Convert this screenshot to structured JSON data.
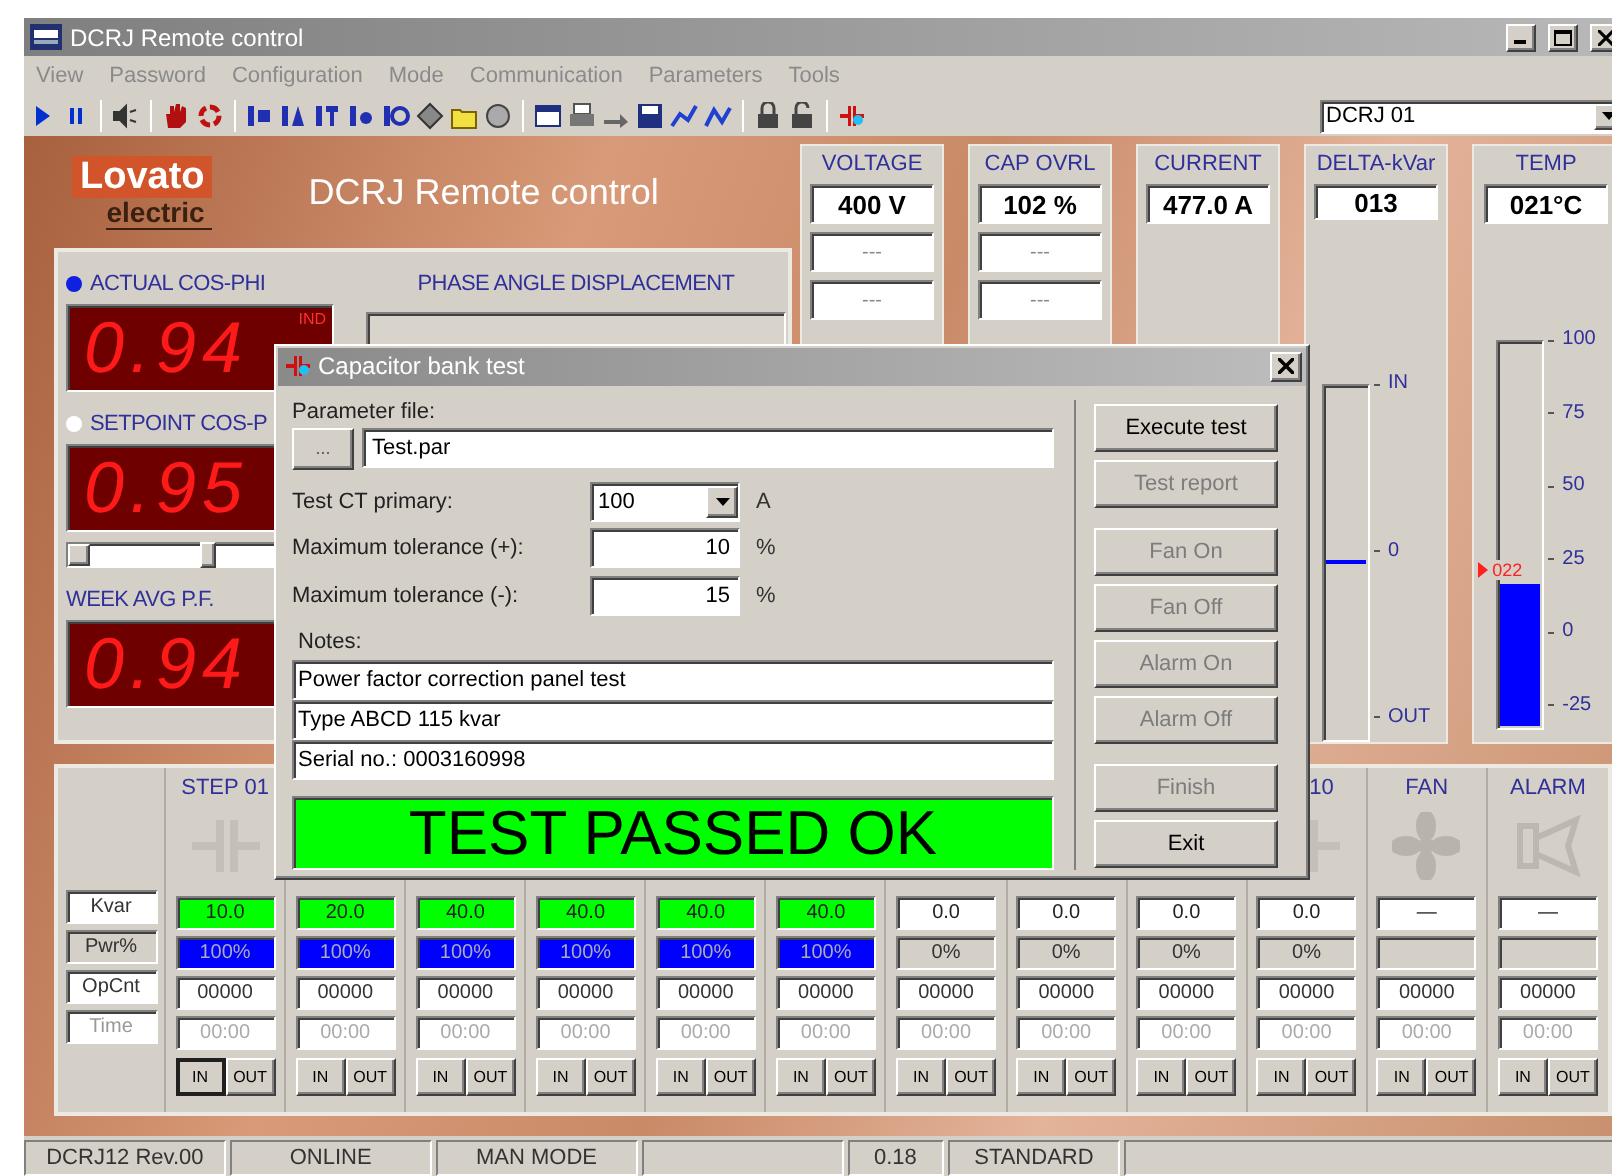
{
  "window": {
    "title": "DCRJ Remote control"
  },
  "menu": [
    "View",
    "Password",
    "Configuration",
    "Mode",
    "Communication",
    "Parameters",
    "Tools"
  ],
  "device_select": {
    "value": "DCRJ 01"
  },
  "header": {
    "logo_top": "Lovato",
    "logo_bottom": "electric",
    "title": "DCRJ Remote control"
  },
  "cos_phi": {
    "displays": [
      {
        "label": "ACTUAL COS-PHI",
        "selected": true,
        "value": "0.94",
        "unit": "IND"
      },
      {
        "label": "SETPOINT COS-P",
        "selected": false,
        "value": "0.95",
        "slider": {
          "level": 0.5
        }
      },
      {
        "label": "WEEK AVG P.F.",
        "value": "0.94"
      }
    ],
    "phase_angle": {
      "label": "PHASE ANGLE DISPLACEMENT"
    }
  },
  "meters": [
    {
      "label": "VOLTAGE",
      "value": "400 V",
      "extra": [
        "---",
        "---"
      ]
    },
    {
      "label": "CAP OVRL",
      "value": "102 %",
      "extra": [
        "---",
        "---"
      ]
    },
    {
      "label": "CURRENT",
      "value": "477.0 A"
    },
    {
      "label": "DELTA-kVar",
      "value": "013",
      "gauge": {
        "kind": "marker",
        "level": 0.5,
        "ticks": [
          "IN",
          "0",
          "OUT"
        ]
      }
    },
    {
      "label": "TEMP",
      "value": "021°C",
      "gauge": {
        "kind": "fill",
        "level": 0.376,
        "reading": "022",
        "ticks": [
          "100",
          "75",
          "50",
          "25",
          "0",
          "-25"
        ]
      }
    }
  ],
  "steps": {
    "row_labels": [
      "Kvar",
      "Pwr%",
      "OpCnt",
      "Time"
    ],
    "columns": [
      {
        "header": "STEP 01",
        "kind": "step",
        "kvar": "10.0",
        "active": true,
        "power": "100%",
        "opcnt": "00000",
        "time": "00:00",
        "buttons": [
          {
            "label": "IN",
            "selected": true
          },
          {
            "label": "OUT",
            "selected": false
          }
        ]
      },
      {
        "kvar": "20.0",
        "active": true,
        "power": "100%",
        "opcnt": "00000",
        "time": "00:00",
        "buttons": [
          {
            "label": "IN",
            "selected": false
          },
          {
            "label": "OUT",
            "selected": false
          }
        ]
      },
      {
        "kvar": "40.0",
        "active": true,
        "power": "100%",
        "opcnt": "00000",
        "time": "00:00",
        "buttons": [
          {
            "label": "IN",
            "selected": false
          },
          {
            "label": "OUT",
            "selected": false
          }
        ]
      },
      {
        "kvar": "40.0",
        "active": true,
        "power": "100%",
        "opcnt": "00000",
        "time": "00:00",
        "buttons": [
          {
            "label": "IN",
            "selected": false
          },
          {
            "label": "OUT",
            "selected": false
          }
        ]
      },
      {
        "kvar": "40.0",
        "active": true,
        "power": "100%",
        "opcnt": "00000",
        "time": "00:00",
        "buttons": [
          {
            "label": "IN",
            "selected": false
          },
          {
            "label": "OUT",
            "selected": false
          }
        ]
      },
      {
        "kvar": "40.0",
        "active": true,
        "power": "100%",
        "opcnt": "00000",
        "time": "00:00",
        "buttons": [
          {
            "label": "IN",
            "selected": false
          },
          {
            "label": "OUT",
            "selected": false
          }
        ]
      },
      {
        "kvar": "0.0",
        "active": false,
        "power": "0%",
        "opcnt": "00000",
        "time": "00:00",
        "buttons": [
          {
            "label": "IN",
            "selected": false
          },
          {
            "label": "OUT",
            "selected": false
          }
        ]
      },
      {
        "kvar": "0.0",
        "active": false,
        "power": "0%",
        "opcnt": "00000",
        "time": "00:00",
        "buttons": [
          {
            "label": "IN",
            "selected": false
          },
          {
            "label": "OUT",
            "selected": false
          }
        ]
      },
      {
        "kvar": "0.0",
        "active": false,
        "power": "0%",
        "opcnt": "00000",
        "time": "00:00",
        "buttons": [
          {
            "label": "IN",
            "selected": false
          },
          {
            "label": "OUT",
            "selected": false
          }
        ]
      },
      {
        "header": "10",
        "kind": "step",
        "kvar": "0.0",
        "active": false,
        "power": "0%",
        "opcnt": "00000",
        "time": "00:00",
        "buttons": [
          {
            "label": "IN",
            "selected": false
          },
          {
            "label": "OUT",
            "selected": false
          }
        ]
      },
      {
        "header": "FAN",
        "kind": "fan",
        "kvar": "—",
        "active": false,
        "opcnt": "00000",
        "time": "00:00",
        "buttons": [
          {
            "label": "IN",
            "selected": false
          },
          {
            "label": "OUT",
            "selected": false
          }
        ]
      },
      {
        "header": "ALARM",
        "kind": "alarm",
        "kvar": "—",
        "active": false,
        "opcnt": "00000",
        "time": "00:00",
        "buttons": [
          {
            "label": "IN",
            "selected": false
          },
          {
            "label": "OUT",
            "selected": false
          }
        ]
      }
    ]
  },
  "status_bar": [
    "DCRJ12 Rev.00",
    "ONLINE",
    "MAN MODE",
    "0.18",
    "STANDARD"
  ],
  "dialog": {
    "title": "Capacitor bank test",
    "parameter_file": {
      "label": "Parameter file:",
      "browse": "...",
      "value": "Test.par"
    },
    "fields": [
      {
        "kind": "select",
        "label": "Test CT primary:",
        "value": "100",
        "unit": "A"
      },
      {
        "kind": "input",
        "label": "Maximum tolerance (+):",
        "value": "10",
        "unit": "%"
      },
      {
        "kind": "input",
        "label": "Maximum tolerance (-):",
        "value": "15",
        "unit": "%"
      }
    ],
    "notes": {
      "label": "Notes:",
      "lines": [
        "Power factor correction panel test",
        "Type ABCD 115 kvar",
        "Serial no.: 0003160998"
      ]
    },
    "result": "TEST PASSED OK",
    "button_groups": [
      {
        "buttons": [
          {
            "label": "Execute test",
            "disabled": false
          },
          {
            "label": "Test report",
            "disabled": true
          }
        ]
      },
      {
        "buttons": [
          {
            "label": "Fan On",
            "disabled": true
          },
          {
            "label": "Fan Off",
            "disabled": true
          },
          {
            "label": "Alarm On",
            "disabled": true
          },
          {
            "label": "Alarm Off",
            "disabled": true
          }
        ]
      },
      {
        "buttons": [
          {
            "label": "Finish",
            "disabled": true
          },
          {
            "label": "Exit",
            "disabled": false
          }
        ]
      }
    ]
  }
}
